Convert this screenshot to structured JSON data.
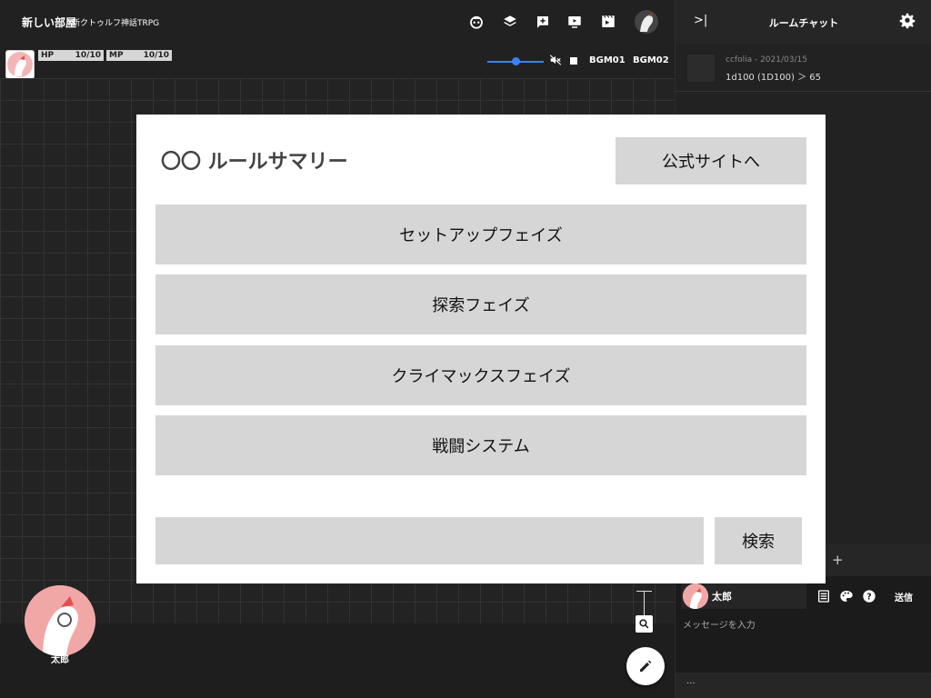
{
  "header": {
    "room_title": "新しい部屋",
    "room_subtitle": "新クトゥルフ神話TRPG",
    "icons": [
      "character-icon",
      "layers-icon",
      "add-panel-icon",
      "screen-icon",
      "scene-icon"
    ]
  },
  "status": {
    "hp_label": "HP",
    "hp_value": "10/10",
    "mp_label": "MP",
    "mp_value": "10/10",
    "volume_fraction": 0.5,
    "bgm1": "BGM01",
    "bgm2": "BGM02"
  },
  "chat_panel": {
    "title": "ルームチャット",
    "message": {
      "name": "ccfolia",
      "date": "- 2021/03/15",
      "text": "1d100 (1D100) ＞ 65"
    },
    "composer": {
      "name": "太郎",
      "send": "送信",
      "placeholder": "メッセージを入力"
    },
    "footer": "..."
  },
  "board": {
    "character_name": "太郎"
  },
  "modal": {
    "title": "〇〇 ルールサマリー",
    "official_site": "公式サイトへ",
    "phases": [
      "セットアップフェイズ",
      "探索フェイズ",
      "クライマックスフェイズ",
      "戦闘システム"
    ],
    "search_value": "",
    "search_button": "検索"
  },
  "colors": {
    "accent": "#3b82f6",
    "button_gray": "#d6d6d6",
    "dark_bg": "#1f1f1f"
  }
}
